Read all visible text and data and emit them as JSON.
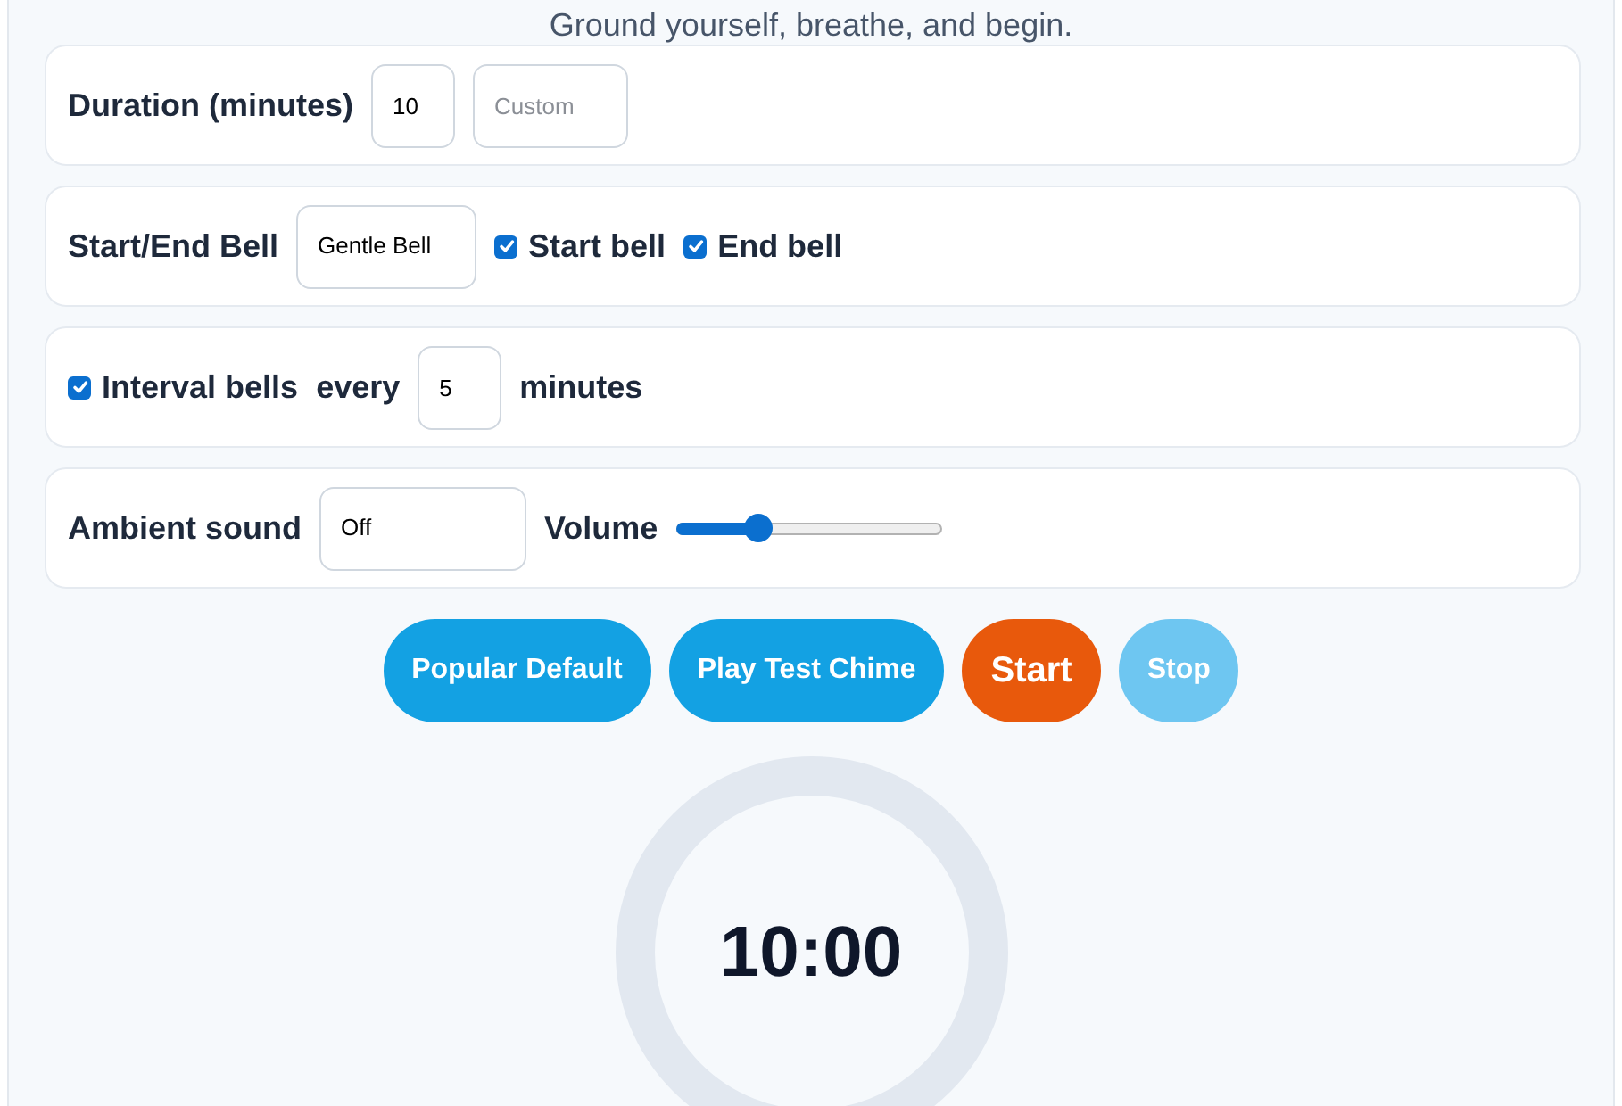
{
  "header": {
    "subtitle": "Ground yourself, breathe, and begin."
  },
  "settings": [
    {
      "items": [
        {
          "kind": "label",
          "text": "Duration (minutes)"
        },
        {
          "kind": "number",
          "value": "10"
        },
        {
          "kind": "text",
          "placeholder": "Custom"
        }
      ]
    },
    {
      "items": [
        {
          "kind": "label",
          "text": "Start/End Bell"
        },
        {
          "kind": "select",
          "value": "Gentle Bell"
        },
        {
          "kind": "checkbox",
          "label": "Start bell",
          "checked": true
        },
        {
          "kind": "checkbox",
          "label": "End bell",
          "checked": true
        }
      ]
    },
    {
      "items": [
        {
          "kind": "checkbox",
          "label": "Interval bells",
          "checked": true
        },
        {
          "kind": "label",
          "text": "every"
        },
        {
          "kind": "number",
          "value": "5"
        },
        {
          "kind": "label",
          "text": "minutes"
        }
      ]
    },
    {
      "items": [
        {
          "kind": "label",
          "text": "Ambient sound"
        },
        {
          "kind": "select",
          "value": "Off"
        },
        {
          "kind": "label",
          "text": "Volume"
        },
        {
          "kind": "slider",
          "level": 0.31
        }
      ]
    }
  ],
  "buttons": [
    {
      "label": "Popular Default",
      "kind": "secondary",
      "disabled": false
    },
    {
      "label": "Play Test Chime",
      "kind": "secondary",
      "disabled": false
    },
    {
      "label": "Start",
      "kind": "primary",
      "disabled": false
    },
    {
      "label": "Stop",
      "kind": "secondary",
      "disabled": true
    }
  ],
  "timer": {
    "time": "10:00"
  }
}
